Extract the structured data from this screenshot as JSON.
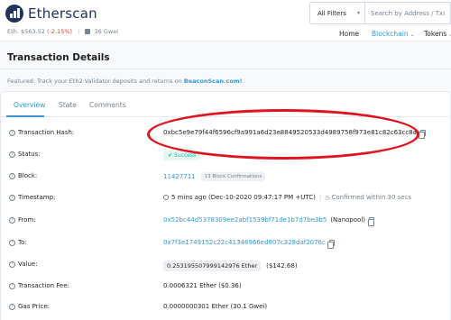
{
  "brand": {
    "name": "Etherscan"
  },
  "ticker": {
    "price": "Eth: $563.52",
    "change": "(-2.15%)",
    "separator": "|",
    "gas": "36 Gwei"
  },
  "search": {
    "filter_label": "All Filters",
    "placeholder": "Search by Address / Txn Hash"
  },
  "nav": [
    {
      "label": "Home"
    },
    {
      "label": "Blockchain"
    },
    {
      "label": "Tokens"
    }
  ],
  "page": {
    "title": "Transaction Details",
    "featured_prefix": "Featured: Track your Eth2 Validator deposits and returns on ",
    "featured_link": "BeaconScan.com!"
  },
  "tabs": [
    {
      "label": "Overview"
    },
    {
      "label": "State"
    },
    {
      "label": "Comments"
    }
  ],
  "details": {
    "hash_label": "Transaction Hash:",
    "hash_value": "0xbc5e9e79f44f6596cf9a991a6d23e8849520533d4989758f973e81c82c63cc8a",
    "status_label": "Status:",
    "status_value": "Success",
    "block_label": "Block:",
    "block_value": "11427711",
    "block_confirmations": "13 Block Confirmations",
    "timestamp_label": "Timestamp:",
    "timestamp_value": "5 mins ago (Dec-10-2020 09:47:17 PM +UTC)",
    "timestamp_confirmed": "Confirmed within 30 secs",
    "from_label": "From:",
    "from_value": "0x52bc44d5378309ee2abf1539bf71de1b7d7be3b5",
    "from_tag": "(Nanopool)",
    "to_label": "To:",
    "to_value": "0x7f3e1749152c22c41348966ed807c328daf2076c",
    "value_label": "Value:",
    "value_ether": "0.253195507999142976 Ether",
    "value_usd": "($142.68)",
    "fee_label": "Transaction Fee:",
    "fee_value": "0.0006321 Ether ($0.36)",
    "gas_label": "Gas Price:",
    "gas_value": "0.0000000301 Ether (30.1 Gwei)"
  },
  "colors": {
    "accent": "#3498db",
    "brand": "#21325b",
    "success": "#00c9a7",
    "annotation": "#e0141e"
  }
}
